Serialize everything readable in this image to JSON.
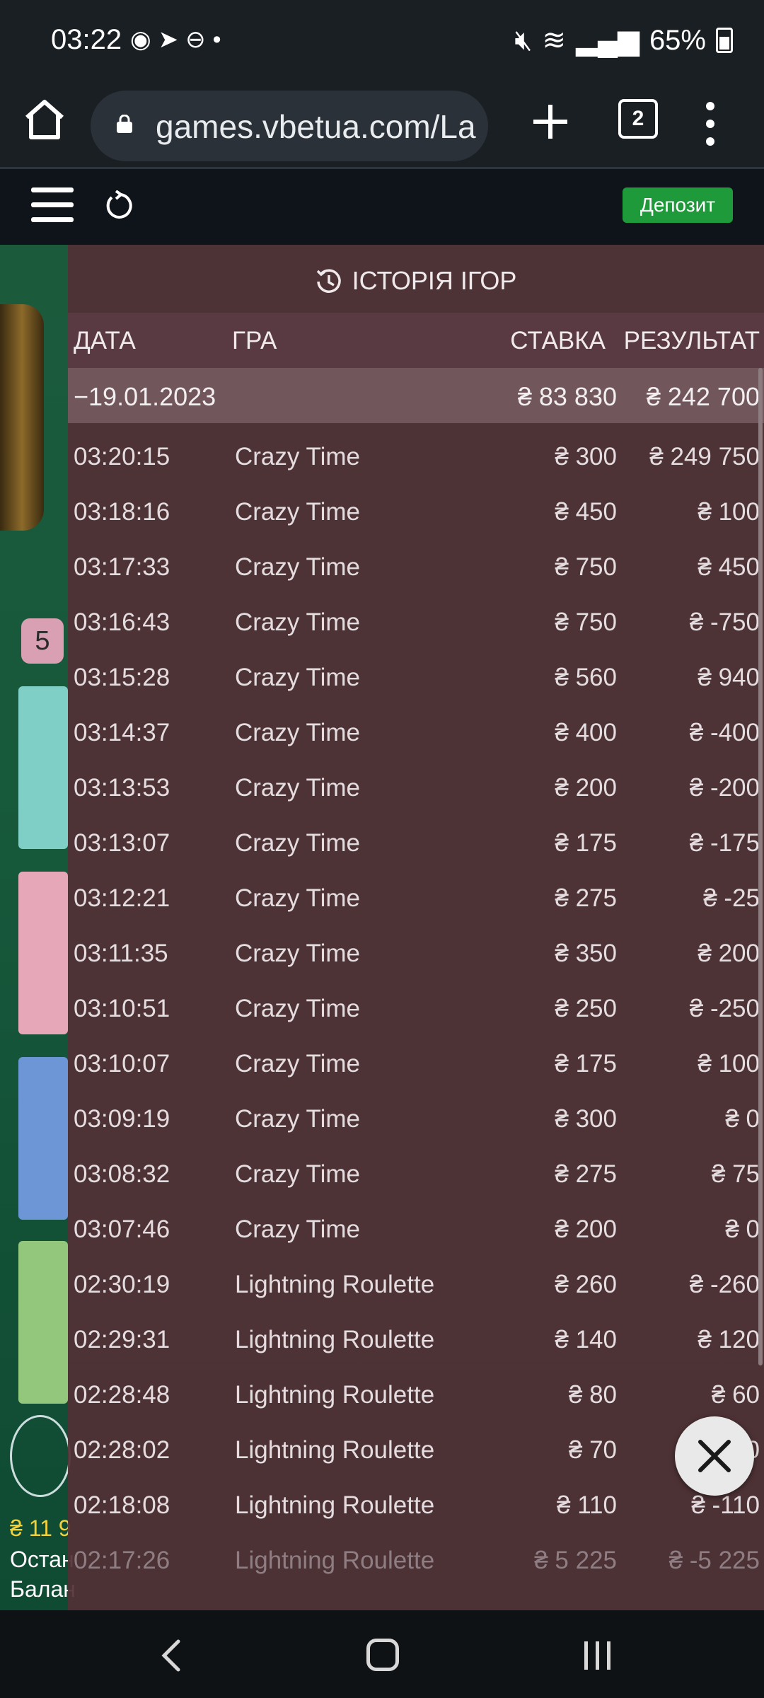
{
  "status_bar": {
    "time": "03:22",
    "left_icons": [
      "media-icon",
      "telegram-icon",
      "do-not-disturb-icon",
      "dot-icon"
    ],
    "battery": "65%",
    "right_icons": [
      "mute-icon",
      "wifi-icon",
      "signal-icon",
      "battery-icon"
    ]
  },
  "browser": {
    "url": "games.vbetua.com/La",
    "tab_count": "2"
  },
  "header": {
    "deposit_label": "Депозит",
    "accent": "#1e9a3b"
  },
  "background": {
    "badge": "5",
    "balance_line_1": "₴ 11 9",
    "balance_line_2": "Остан",
    "balance_line_3": "Балан"
  },
  "history": {
    "title": "ІСТОРІЯ ІГОР",
    "columns": {
      "date": "ДАТА",
      "game": "ГРА",
      "bet": "СТАВКА",
      "result": "РЕЗУЛЬТАТ"
    },
    "date_group": {
      "date": "−19.01.2023",
      "bet_total": "₴ 83 830",
      "result_total": "₴ 242 700"
    },
    "rows": [
      {
        "time": "03:20:15",
        "game": "Crazy Time",
        "bet": "₴ 300",
        "result": "₴ 249 750"
      },
      {
        "time": "03:18:16",
        "game": "Crazy Time",
        "bet": "₴ 450",
        "result": "₴ 100"
      },
      {
        "time": "03:17:33",
        "game": "Crazy Time",
        "bet": "₴ 750",
        "result": "₴ 450"
      },
      {
        "time": "03:16:43",
        "game": "Crazy Time",
        "bet": "₴ 750",
        "result": "₴ -750"
      },
      {
        "time": "03:15:28",
        "game": "Crazy Time",
        "bet": "₴ 560",
        "result": "₴ 940"
      },
      {
        "time": "03:14:37",
        "game": "Crazy Time",
        "bet": "₴ 400",
        "result": "₴ -400"
      },
      {
        "time": "03:13:53",
        "game": "Crazy Time",
        "bet": "₴ 200",
        "result": "₴ -200"
      },
      {
        "time": "03:13:07",
        "game": "Crazy Time",
        "bet": "₴ 175",
        "result": "₴ -175"
      },
      {
        "time": "03:12:21",
        "game": "Crazy Time",
        "bet": "₴ 275",
        "result": "₴ -25"
      },
      {
        "time": "03:11:35",
        "game": "Crazy Time",
        "bet": "₴ 350",
        "result": "₴ 200"
      },
      {
        "time": "03:10:51",
        "game": "Crazy Time",
        "bet": "₴ 250",
        "result": "₴ -250"
      },
      {
        "time": "03:10:07",
        "game": "Crazy Time",
        "bet": "₴ 175",
        "result": "₴ 100"
      },
      {
        "time": "03:09:19",
        "game": "Crazy Time",
        "bet": "₴ 300",
        "result": "₴ 0"
      },
      {
        "time": "03:08:32",
        "game": "Crazy Time",
        "bet": "₴ 275",
        "result": "₴ 75"
      },
      {
        "time": "03:07:46",
        "game": "Crazy Time",
        "bet": "₴ 200",
        "result": "₴ 0"
      },
      {
        "time": "02:30:19",
        "game": "Lightning Roulette",
        "bet": "₴ 260",
        "result": "₴ -260"
      },
      {
        "time": "02:29:31",
        "game": "Lightning Roulette",
        "bet": "₴ 140",
        "result": "₴ 120"
      },
      {
        "time": "02:28:48",
        "game": "Lightning Roulette",
        "bet": "₴ 80",
        "result": "₴ 60"
      },
      {
        "time": "02:28:02",
        "game": "Lightning Roulette",
        "bet": "₴ 70",
        "result": "10"
      },
      {
        "time": "02:18:08",
        "game": "Lightning Roulette",
        "bet": "₴ 110",
        "result": "₴ -110"
      },
      {
        "time": "02:17:26",
        "game": "Lightning Roulette",
        "bet": "₴ 5 225",
        "result": "₴ -5 225"
      }
    ]
  }
}
